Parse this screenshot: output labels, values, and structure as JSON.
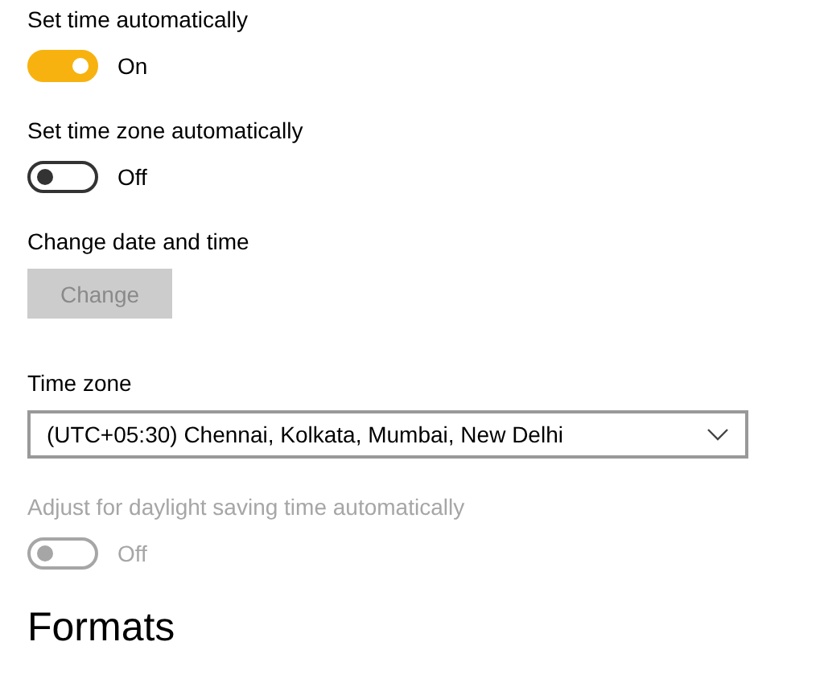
{
  "settings": [
    {
      "kind": "toggle",
      "label": "Set time automatically",
      "on": true,
      "disabled": false,
      "state_text": "On"
    },
    {
      "kind": "toggle",
      "label": "Set time zone automatically",
      "on": false,
      "disabled": false,
      "state_text": "Off"
    },
    {
      "kind": "button",
      "label": "Change date and time",
      "button_label": "Change",
      "disabled": true
    },
    {
      "kind": "dropdown",
      "label": "Time zone",
      "value": "(UTC+05:30) Chennai, Kolkata, Mumbai, New Delhi"
    },
    {
      "kind": "toggle",
      "label": "Adjust for daylight saving time automatically",
      "on": false,
      "disabled": true,
      "state_text": "Off"
    }
  ],
  "section_heading": "Formats"
}
